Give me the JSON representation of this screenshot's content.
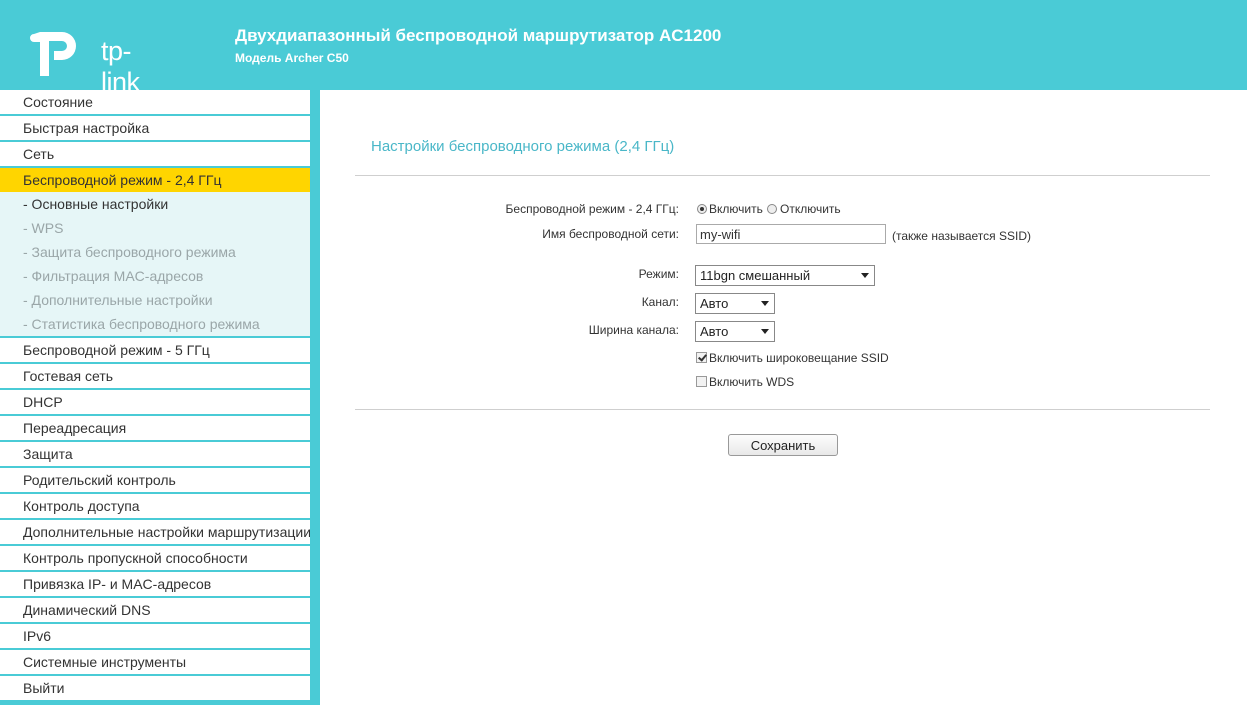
{
  "header": {
    "logo_text": "tp-link",
    "title": "Двухдиапазонный беспроводной маршрутизатор AC1200",
    "model": "Модель Archer C50",
    "bg_color": "#4acbd6"
  },
  "sidebar": {
    "items": [
      {
        "label": "Состояние"
      },
      {
        "label": "Быстрая настройка"
      },
      {
        "label": "Сеть"
      },
      {
        "label": "Беспроводной режим - 2,4 ГГц",
        "active": true
      },
      {
        "label": "Беспроводной режим - 5 ГГц"
      },
      {
        "label": "Гостевая сеть"
      },
      {
        "label": "DHCP"
      },
      {
        "label": "Переадресация"
      },
      {
        "label": "Защита"
      },
      {
        "label": "Родительский контроль"
      },
      {
        "label": "Контроль доступа"
      },
      {
        "label": "Дополнительные настройки маршрутизации"
      },
      {
        "label": "Контроль пропускной способности"
      },
      {
        "label": "Привязка IP- и MAC-адресов"
      },
      {
        "label": "Динамический DNS"
      },
      {
        "label": "IPv6"
      },
      {
        "label": "Системные инструменты"
      },
      {
        "label": "Выйти"
      }
    ],
    "submenu": [
      {
        "label": "- Основные настройки",
        "current": true
      },
      {
        "label": "- WPS"
      },
      {
        "label": "- Защита беспроводного режима"
      },
      {
        "label": "- Фильтрация MAC-адресов"
      },
      {
        "label": "- Дополнительные настройки"
      },
      {
        "label": "- Статистика беспроводного режима"
      }
    ],
    "active_color": "#ffd500"
  },
  "main": {
    "section_title": "Настройки беспроводного режима (2,4 ГГц)",
    "wireless_label": "Беспроводной режим - 2,4 ГГц:",
    "radio_on": "Включить",
    "radio_off": "Отключить",
    "ssid_label": "Имя беспроводной сети:",
    "ssid_value": "my-wifi",
    "ssid_note": "(также называется SSID)",
    "mode_label": "Режим:",
    "mode_value": "11bgn смешанный",
    "channel_label": "Канал:",
    "channel_value": "Авто",
    "width_label": "Ширина канала:",
    "width_value": "Авто",
    "ssid_broadcast": "Включить широковещание SSID",
    "ssid_broadcast_checked": true,
    "wds": "Включить WDS",
    "wds_checked": false,
    "save_label": "Сохранить"
  }
}
